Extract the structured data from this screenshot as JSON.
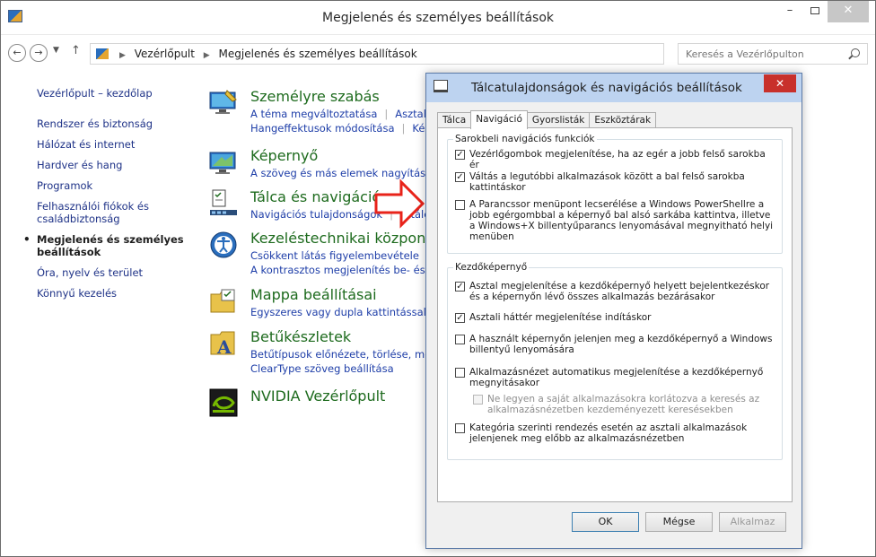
{
  "window": {
    "title": "Megjelenés és személyes beállítások",
    "minimize": "–",
    "close": "✕"
  },
  "address": {
    "crumbs": [
      "Vezérlőpult",
      "Megjelenés és személyes beállítások"
    ],
    "search_placeholder": "Keresés a Vezérlőpulton"
  },
  "sidebar": {
    "items": [
      "Vezérlőpult – kezdőlap",
      "Rendszer és biztonság",
      "Hálózat és internet",
      "Hardver és hang",
      "Programok",
      "Felhasználói fiókok és családbiztonság",
      "Megjelenés és személyes beállítások",
      "Óra, nyelv és terület",
      "Könnyű kezelés"
    ],
    "bullet": "•"
  },
  "categories": [
    {
      "title": "Személyre szabás",
      "links": [
        "A téma megváltoztatása",
        "Asztalh",
        "Hangeffektusok módosítása",
        "Kép"
      ]
    },
    {
      "title": "Képernyő",
      "links": [
        "A szöveg és más elemek nagyítása va"
      ]
    },
    {
      "title": "Tálca és navigáció",
      "links": [
        "Navigációs tulajdonságok",
        "A tálca"
      ]
    },
    {
      "title": "Kezeléstechnikai központ",
      "links": [
        "Csökkent látás figyelembevétele",
        "A kontrasztos megjelenítés be- és kik"
      ]
    },
    {
      "title": "Mappa beállításai",
      "links": [
        "Egyszeres vagy dupla kattintással tör"
      ]
    },
    {
      "title": "Betűkészletek",
      "links": [
        "Betűtípusok előnézete, törlése, megje",
        "ClearType szöveg beállítása"
      ]
    },
    {
      "title": "NVIDIA Vezérlőpult",
      "links": []
    }
  ],
  "dialog": {
    "title": "Tálcatulajdonságok és navigációs beállítások",
    "close": "✕",
    "tabs": [
      "Tálca",
      "Navigáció",
      "Gyorslisták",
      "Eszköztárak"
    ],
    "active_tab": "Navigáció",
    "groups": [
      {
        "legend": "Sarokbeli navigációs funkciók",
        "options": [
          {
            "label": "Vezérlőgombok megjelenítése, ha az egér a jobb felső sarokba ér",
            "checked": true,
            "enabled": true
          },
          {
            "label": "Váltás a legutóbbi alkalmazások között a bal felső sarokba kattintáskor",
            "checked": true,
            "enabled": true
          },
          {
            "label": "A Parancssor menüpont lecserélése a Windows PowerShellre a jobb egérgombbal a képernyő bal alsó sarkába kattintva, illetve a Windows+X billentyűparancs lenyomásával megnyitható helyi menüben",
            "checked": false,
            "enabled": true
          }
        ]
      },
      {
        "legend": "Kezdőképernyő",
        "options": [
          {
            "label": "Asztal megjelenítése a kezdőképernyő helyett bejelentkezéskor és a képernyőn lévő összes alkalmazás bezárásakor",
            "checked": true,
            "enabled": true
          },
          {
            "label": "Asztali háttér megjelenítése indításkor",
            "checked": true,
            "enabled": true
          },
          {
            "label": "A használt képernyőn jelenjen meg a kezdőképernyő a Windows billentyű lenyomására",
            "checked": false,
            "enabled": true
          },
          {
            "label": "Alkalmazásnézet automatikus megjelenítése a kezdőképernyő megnyitásakor",
            "checked": false,
            "enabled": true
          },
          {
            "label": "Ne legyen a saját alkalmazásokra korlátozva a keresés az alkalmazásnézetben kezdeményezett keresésekben",
            "checked": false,
            "enabled": false
          },
          {
            "label": "Kategória szerinti rendezés esetén az asztali alkalmazások jelenjenek meg előbb az alkalmazásnézetben",
            "checked": false,
            "enabled": true
          }
        ]
      }
    ],
    "buttons": {
      "ok": "OK",
      "cancel": "Mégse",
      "apply": "Alkalmaz"
    }
  },
  "colors": {
    "link": "#1e3ea8",
    "category_title": "#1e6b1e",
    "dialog_titlebar": "#bdd3f0",
    "close_red": "#c8302b",
    "arrow_red": "#e8231a"
  }
}
